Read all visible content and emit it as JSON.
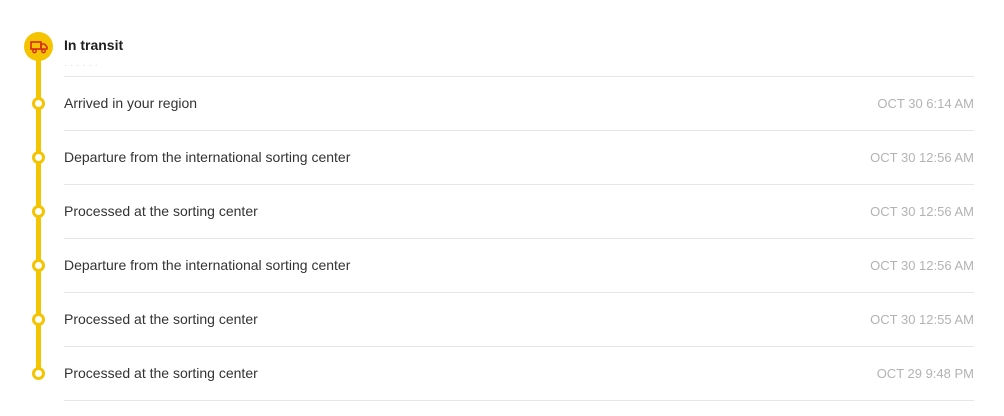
{
  "colors": {
    "accent": "#f5c400",
    "icon": "#d62b1f",
    "divider": "#e6e6e6",
    "time_text": "#b3b3b3"
  },
  "status": {
    "icon": "truck-icon",
    "title": "In transit",
    "subtitle": "· · · · · ·"
  },
  "events": [
    {
      "title": "Arrived in your region",
      "time": "OCT 30 6:14 AM"
    },
    {
      "title": "Departure from the international sorting center",
      "time": "OCT 30 12:56 AM"
    },
    {
      "title": "Processed at the sorting center",
      "time": "OCT 30 12:56 AM"
    },
    {
      "title": "Departure from the international sorting center",
      "time": "OCT 30 12:56 AM"
    },
    {
      "title": "Processed at the sorting center",
      "time": "OCT 30 12:55 AM"
    },
    {
      "title": "Processed at the sorting center",
      "time": "OCT 29 9:48 PM"
    }
  ]
}
